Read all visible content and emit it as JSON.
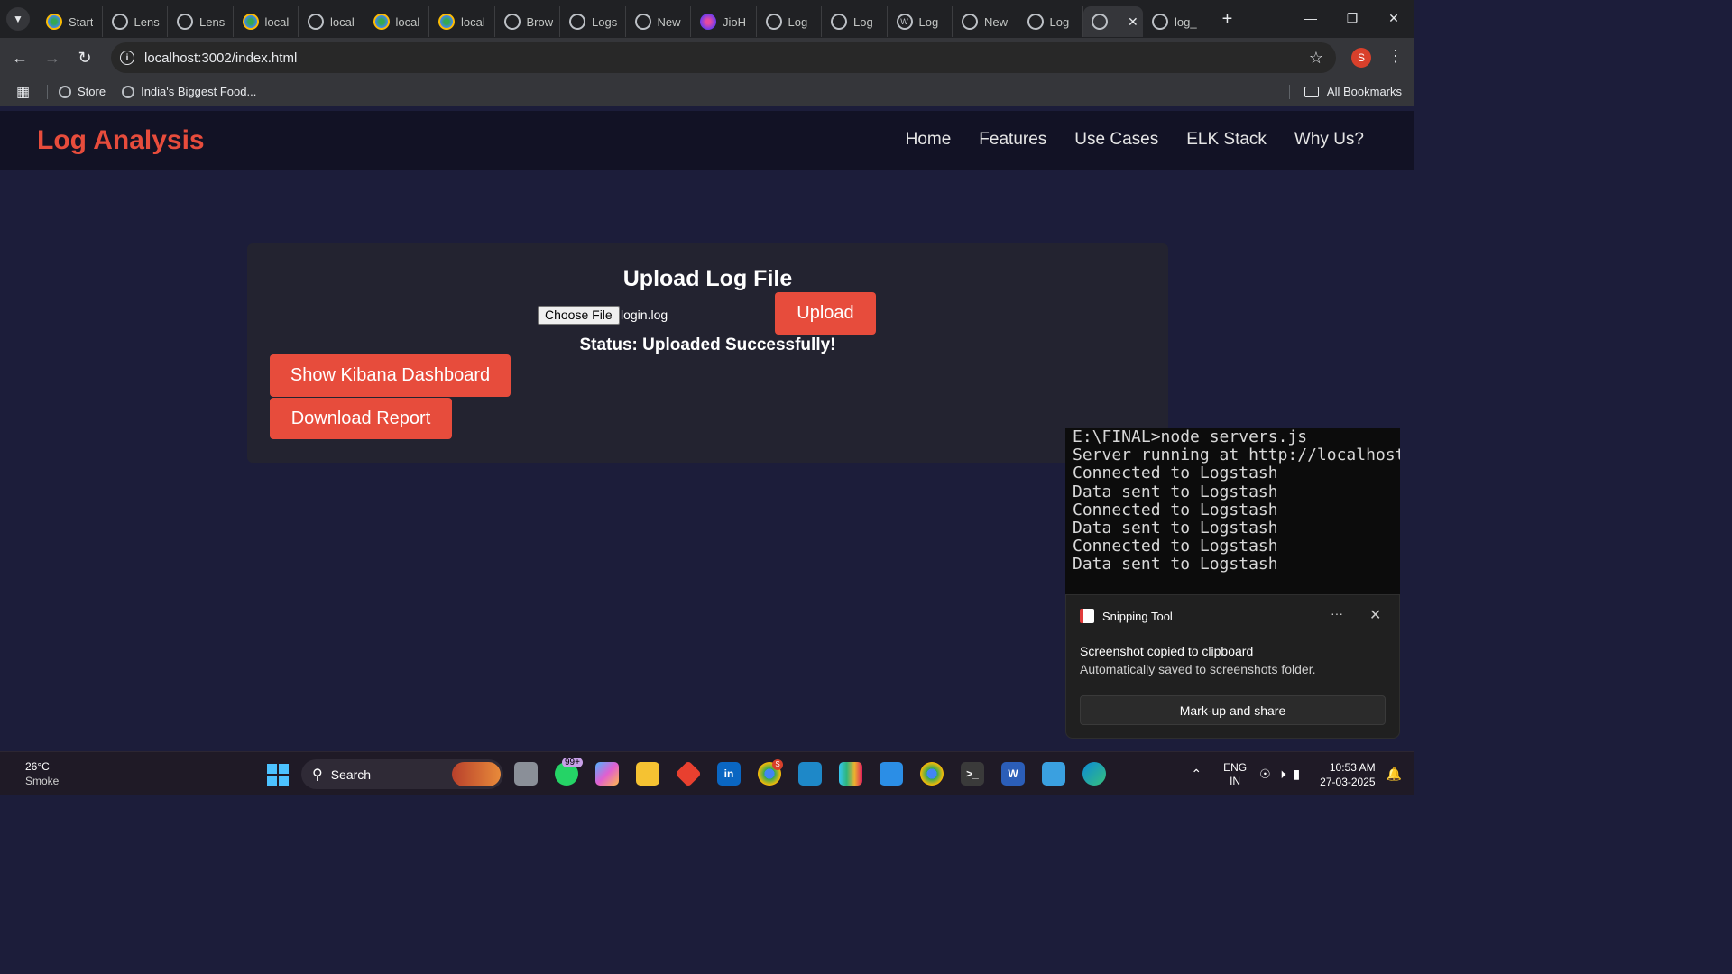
{
  "browser": {
    "tabs": [
      {
        "label": "Start",
        "icon": "chrome-color-icon"
      },
      {
        "label": "Lens",
        "icon": "openai-icon"
      },
      {
        "label": "Lens",
        "icon": "openai-icon"
      },
      {
        "label": "local",
        "icon": "chrome-color-icon"
      },
      {
        "label": "local",
        "icon": "globe-icon"
      },
      {
        "label": "local",
        "icon": "chrome-color-icon"
      },
      {
        "label": "local",
        "icon": "chrome-color-icon"
      },
      {
        "label": "Brow",
        "icon": "openai-icon"
      },
      {
        "label": "Logs",
        "icon": "openai-icon"
      },
      {
        "label": "New",
        "icon": "chrome-icon"
      },
      {
        "label": "JioH",
        "icon": "jio-icon"
      },
      {
        "label": "Log",
        "icon": "globe-icon"
      },
      {
        "label": "Log",
        "icon": "globe-icon"
      },
      {
        "label": "Log",
        "icon": "wordpress-icon"
      },
      {
        "label": "New",
        "icon": "chrome-icon"
      },
      {
        "label": "Log",
        "icon": "globe-icon"
      }
    ],
    "active_tab_icon": "globe-icon",
    "trailing_tab": {
      "label": "log_"
    },
    "url": "localhost:3002/index.html",
    "profile_initial": "S",
    "bookmarks": [
      {
        "label": "Store"
      },
      {
        "label": "India's Biggest Food..."
      }
    ],
    "all_bookmarks_label": "All Bookmarks"
  },
  "site": {
    "logo": "Log Analysis",
    "nav": [
      "Home",
      "Features",
      "Use Cases",
      "ELK Stack",
      "Why Us?"
    ],
    "upload": {
      "title": "Upload Log File",
      "choose_file_label": "Choose File",
      "file_name": "login.log",
      "upload_label": "Upload",
      "status": "Status: Uploaded Successfully!"
    },
    "kibana_label": "Show Kibana Dashboard",
    "report_label": "Download Report",
    "accent_color": "#e74c3c"
  },
  "terminal": {
    "lines": [
      "E:\\FINAL>node servers.js",
      "Server running at http://localhost",
      "Connected to Logstash",
      "Data sent to Logstash",
      "Connected to Logstash",
      "Data sent to Logstash",
      "Connected to Logstash",
      "Data sent to Logstash"
    ]
  },
  "toast": {
    "app_name": "Snipping Tool",
    "more_label": "···",
    "title": "Screenshot copied to clipboard",
    "body": "Automatically saved to screenshots folder.",
    "action_label": "Mark-up and share"
  },
  "taskbar": {
    "weather_temp": "26°C",
    "weather_condition": "Smoke",
    "search_label": "Search",
    "whatsapp_badge": "99+",
    "chrome_badge": "S",
    "lang_line1": "ENG",
    "lang_line2": "IN",
    "time": "10:53 AM",
    "date": "27-03-2025"
  }
}
